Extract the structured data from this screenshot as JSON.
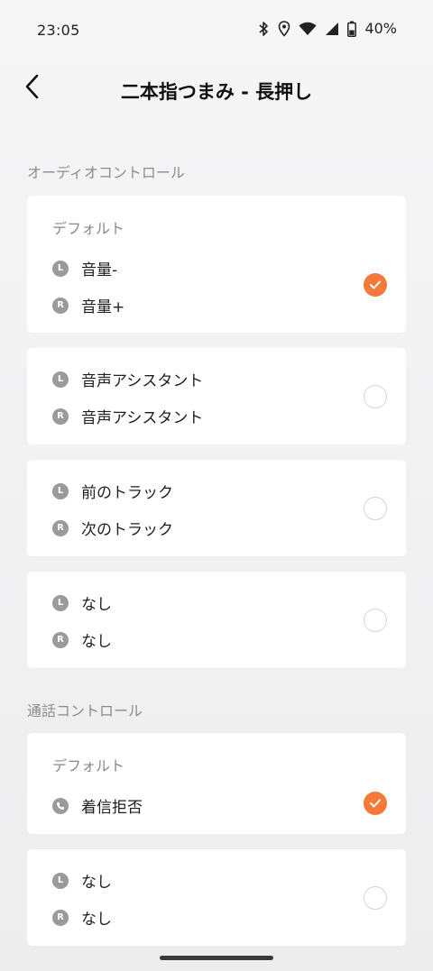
{
  "status_bar": {
    "time": "23:05",
    "battery": "40%"
  },
  "header": {
    "title": "二本指つまみ - 長押し"
  },
  "audio_section": {
    "label": "オーディオコントロール",
    "options": [
      {
        "title": "デフォルト",
        "left": "音量-",
        "right": "音量+",
        "selected": true
      },
      {
        "title": "",
        "left": "音声アシスタント",
        "right": "音声アシスタント",
        "selected": false
      },
      {
        "title": "",
        "left": "前のトラック",
        "right": "次のトラック",
        "selected": false
      },
      {
        "title": "",
        "left": "なし",
        "right": "なし",
        "selected": false
      }
    ]
  },
  "call_section": {
    "label": "通話コントロール",
    "options": [
      {
        "title": "デフォルト",
        "call": "着信拒否",
        "selected": true
      },
      {
        "title": "",
        "left": "なし",
        "right": "なし",
        "selected": false
      }
    ]
  },
  "badges": {
    "left": "L",
    "right": "R"
  },
  "colors": {
    "accent": "#f47a3a",
    "background": "#f2f2f3",
    "card": "#ffffff"
  }
}
